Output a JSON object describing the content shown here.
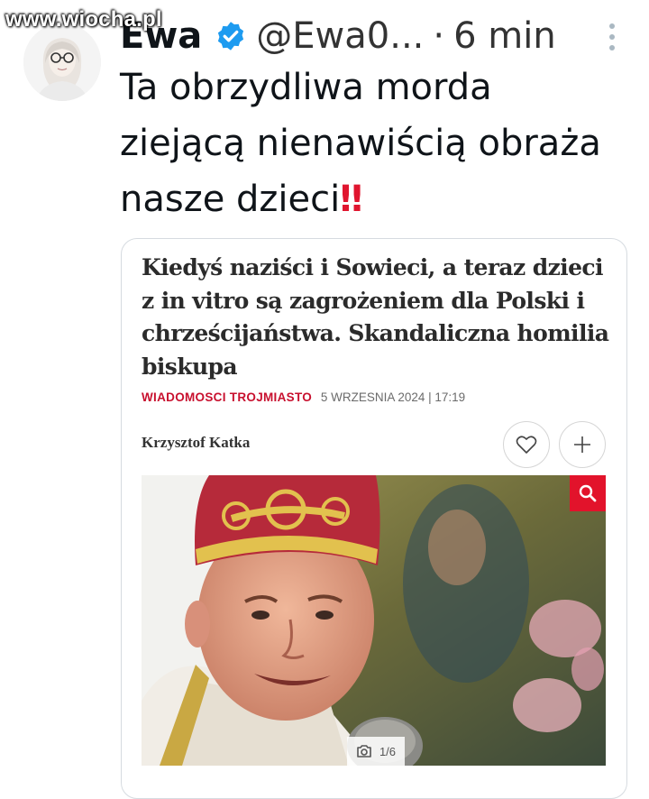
{
  "watermark": "www.wiocha.pl",
  "tweet": {
    "author_name": "Ewa",
    "handle": "@Ewa0...",
    "separator": "·",
    "time": "6 min",
    "text": "Ta obrzydliwa morda ziejącą nienawiścią obraża nasze dzieci",
    "emoji": "‼"
  },
  "article": {
    "headline": "Kiedyś naziści i Sowieci, a teraz dzieci z in vitro są zagrożeniem dla Polski i chrześcijaństwa. Skandaliczna homilia biskupa",
    "section": "WIADOMOSCI TROJMIASTO",
    "date": "5 WRZESNIA 2024 | 17:19",
    "author": "Krzysztof Katka",
    "photo_counter": "1/6"
  },
  "colors": {
    "verified_badge": "#1d9bf0",
    "section_red": "#c8102e",
    "zoom_button": "#e2132b",
    "emoji_red": "#e0152f"
  }
}
